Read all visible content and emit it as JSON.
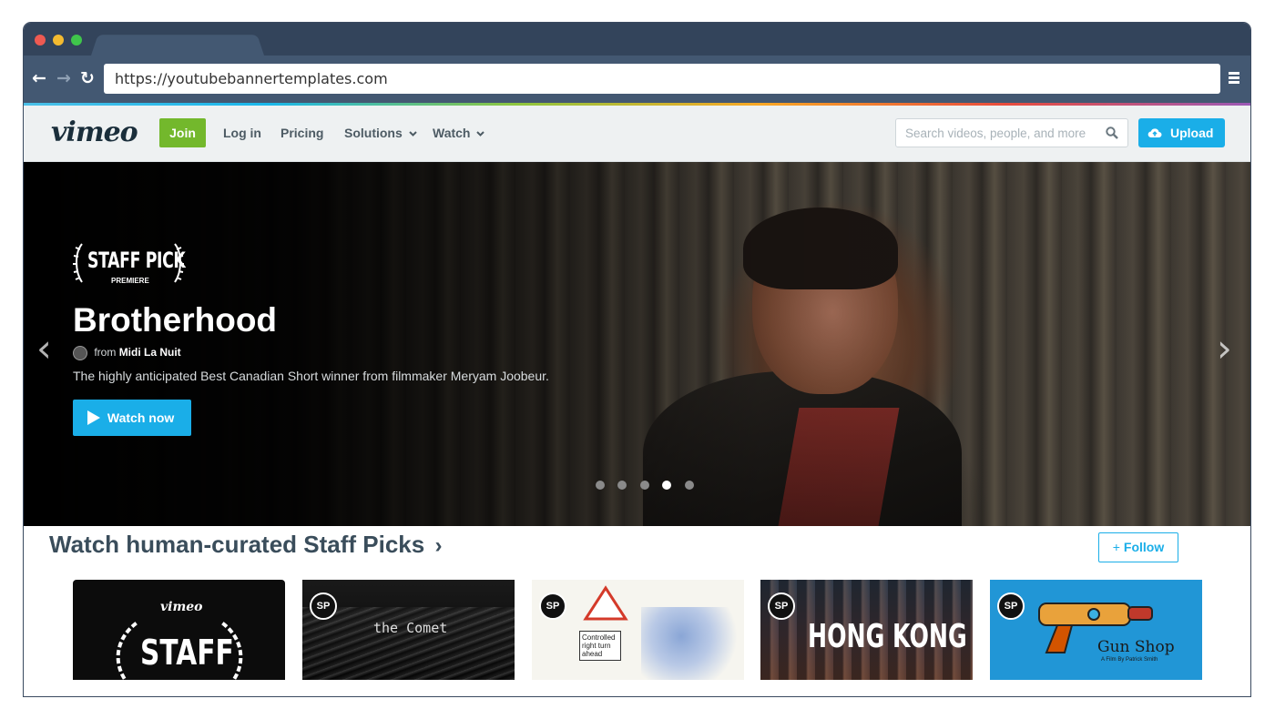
{
  "browser": {
    "url": "https://youtubebannertemplates.com"
  },
  "header": {
    "logo": "vimeo",
    "join": "Join",
    "login": "Log in",
    "pricing": "Pricing",
    "solutions": "Solutions",
    "watch": "Watch",
    "search_placeholder": "Search videos, people, and more",
    "upload": "Upload"
  },
  "hero": {
    "badge_main": "STAFF PICK",
    "badge_sub": "PREMIERE",
    "title": "Brotherhood",
    "from_label": "from",
    "author": "Midi La Nuit",
    "description": "The highly anticipated Best Canadian Short winner from filmmaker Meryam Joobeur.",
    "cta": "Watch now",
    "slide_count": 5,
    "active_slide": 4
  },
  "section": {
    "title": "Watch human-curated Staff Picks",
    "title_chevron": "›",
    "follow": "Follow"
  },
  "thumbnails": [
    {
      "logo": "vimeo",
      "label": "STAFF"
    },
    {
      "badge": "SP",
      "label": "the Comet"
    },
    {
      "badge": "SP",
      "label": "Controlled right turn ahead"
    },
    {
      "badge": "SP",
      "label": "HONG KONG"
    },
    {
      "badge": "SP",
      "label": "Gun Shop",
      "sublabel": "A Film By Patrick Smith"
    }
  ]
}
